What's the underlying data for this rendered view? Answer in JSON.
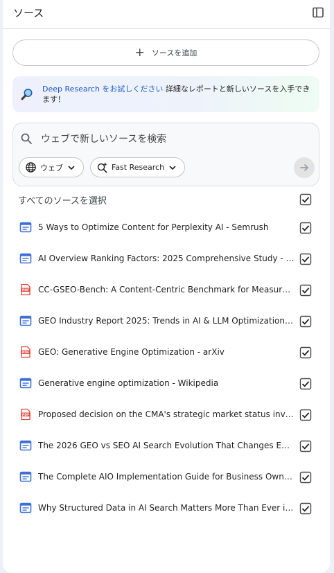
{
  "header": {
    "title": "ソース"
  },
  "add_button": {
    "label": "ソースを追加"
  },
  "promo": {
    "link_text": "Deep Research をお試しください",
    "body_text": " 詳細なレポートと新しいソースを入手できます！"
  },
  "search": {
    "placeholder": "ウェブで新しいソースを検索",
    "chip_web": "ウェブ",
    "chip_research": "Fast Research"
  },
  "select_all": {
    "label": "すべてのソースを選択",
    "checked": true
  },
  "sources": [
    {
      "title": "5 Ways to Optimize Content for Perplexity AI - Semrush",
      "type": "web",
      "checked": true
    },
    {
      "title": "AI Overview Ranking Factors: 2025 Comprehensive Study - …",
      "type": "web",
      "checked": true
    },
    {
      "title": "CC-GSEO-Bench: A Content-Centric Benchmark for Measur…",
      "type": "pdf",
      "checked": true
    },
    {
      "title": "GEO Industry Report 2025: Trends in AI & LLM Optimization …",
      "type": "web",
      "checked": true
    },
    {
      "title": "GEO: Generative Engine Optimization - arXiv",
      "type": "pdf",
      "checked": true
    },
    {
      "title": "Generative engine optimization - Wikipedia",
      "type": "web",
      "checked": true
    },
    {
      "title": "Proposed decision on the CMA's strategic market status inv…",
      "type": "pdf",
      "checked": true
    },
    {
      "title": "The 2026 GEO vs SEO AI Search Evolution That Changes Ev…",
      "type": "web",
      "checked": true
    },
    {
      "title": "The Complete AIO Implementation Guide for Business Owne…",
      "type": "web",
      "checked": true
    },
    {
      "title": "Why Structured Data in AI Search Matters More Than Ever in…",
      "type": "web",
      "checked": true
    }
  ],
  "colors": {
    "web_icon": "#3c6fd8",
    "pdf_icon": "#e2473b",
    "link": "#1a56c4"
  }
}
